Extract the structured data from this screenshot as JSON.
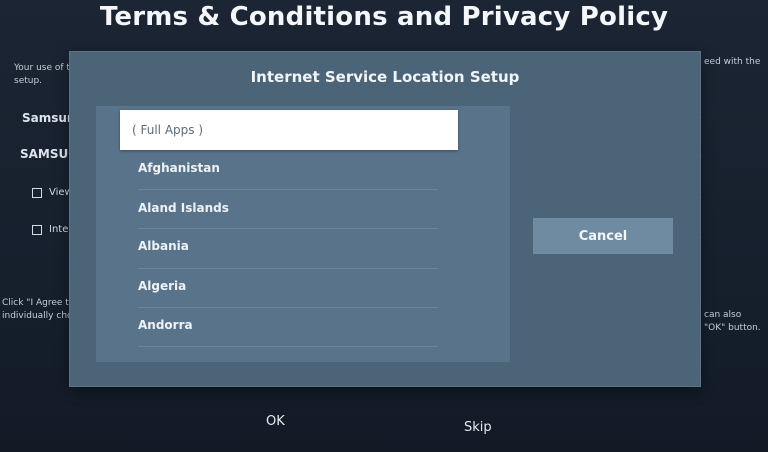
{
  "background": {
    "title": "Terms & Conditions and Privacy Policy",
    "intro_left": "Your use of the S",
    "intro_left_2": "setup.",
    "intro_right": "eed with the",
    "samsung_line_1": "Samsung S",
    "samsung_line_2": "SAMSUNG",
    "checkbox_1": "Viewi",
    "checkbox_2": "Intere",
    "footer_left_1": "Click \"I Agree to a",
    "footer_left_2": "individually choo",
    "footer_right_1": "can also",
    "footer_right_2": "\"OK\" button.",
    "ok_label": "OK",
    "skip_label": "Skip",
    "chevron_glyph": "›"
  },
  "modal": {
    "title": "Internet Service Location Setup",
    "items": [
      {
        "label": "( Full Apps )",
        "selected": true
      },
      {
        "label": "Afghanistan",
        "selected": false
      },
      {
        "label": "Aland Islands",
        "selected": false
      },
      {
        "label": "Albania",
        "selected": false
      },
      {
        "label": "Algeria",
        "selected": false
      },
      {
        "label": "Andorra",
        "selected": false
      }
    ],
    "cancel_label": "Cancel"
  },
  "colors": {
    "modal_bg": "#4b6478",
    "list_bg": "#59748a",
    "selected_bg": "#ffffff",
    "cancel_bg": "#6f8ba1"
  }
}
